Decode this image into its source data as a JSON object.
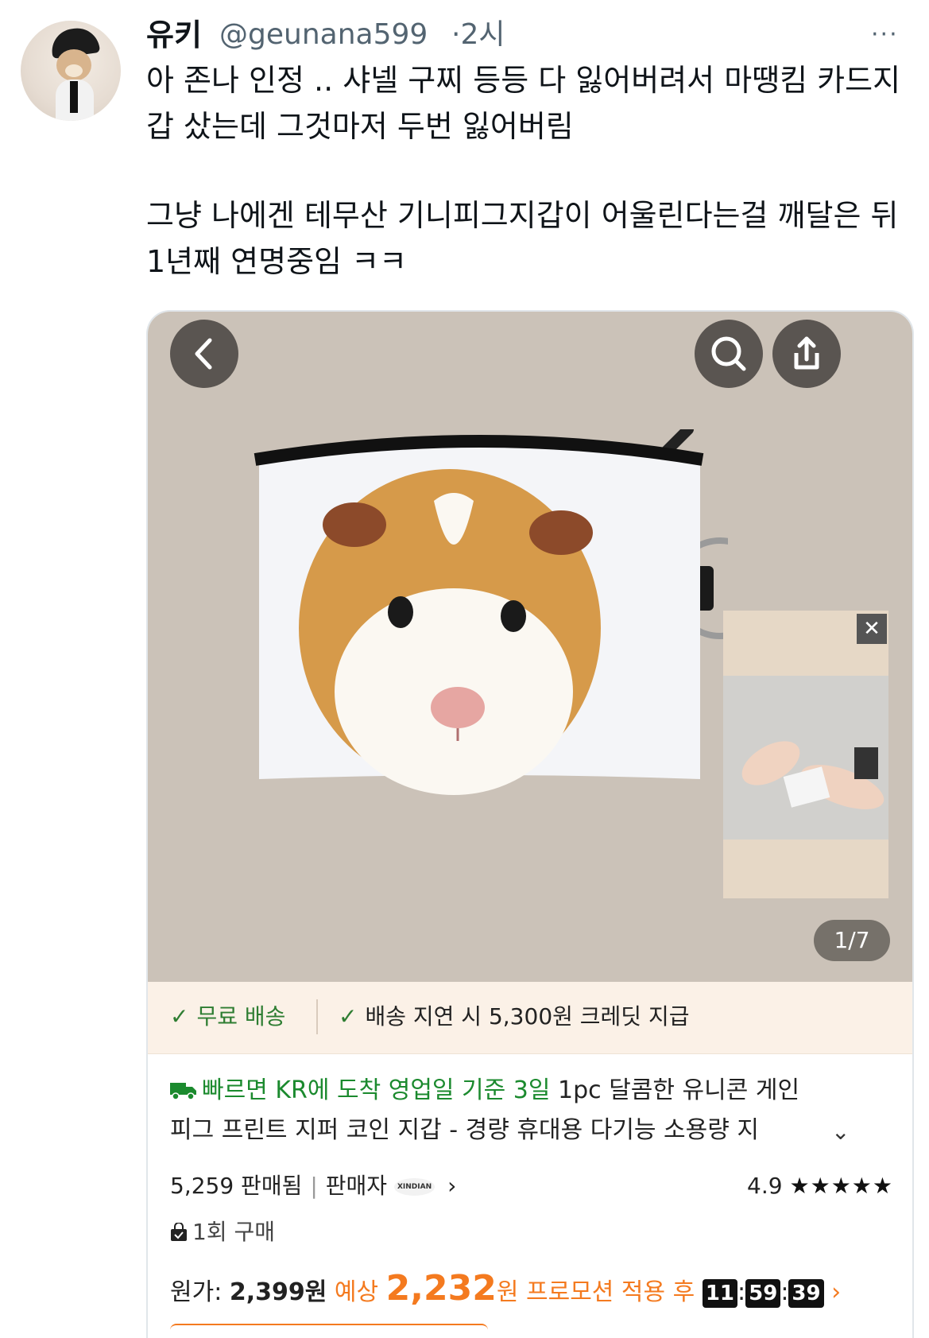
{
  "tweet": {
    "name": "유키",
    "handle": "@geunana599",
    "time": "·2시",
    "more": "···",
    "text_p1": "아 존나 인정 .. 샤넬 구찌 등등 다 잃어버려서 마땡킴 카드지갑 샀는데 그것마저 두번 잃어버림",
    "text_p2": "그냥 나에겐 테무산 기니피그지갑이 어울린다는걸 깨달은 뒤 1년째 연명중임 ㅋㅋ"
  },
  "product": {
    "close": "✕",
    "counter": "1/7",
    "free_shipping": "무료 배송",
    "delay_credit": "배송 지연 시 5,300원 크레딧 지급",
    "delivery": "빠르면 KR에 도착 영업일 기준 3일",
    "title_line1": "1pc 달콤한 유니콘 게인",
    "title_line2": "피그 프린트 지퍼 코인 지갑 - 경량 휴대용 다기능 소용량 지",
    "sold": "5,259 판매됨",
    "seller_label": "판매자",
    "seller_logo": "XINDIAN",
    "rating": "4.9",
    "stars": "★★★★★",
    "purchase": "1회 구매",
    "orig_label": "원가:",
    "orig_price": "2,399원",
    "est_label": "예상",
    "est_price": "2,232",
    "est_unit": "원",
    "promo": "프로모션 적용 후",
    "timer_h": "11",
    "timer_m": "59",
    "timer_s": "39",
    "promo_arrow": "›"
  },
  "icons": [
    "back-icon",
    "search-icon",
    "share-icon",
    "close-icon",
    "check-icon",
    "truck-icon",
    "chevron-down-icon",
    "star-icon",
    "bag-icon"
  ],
  "colors": {
    "green": "#1b8a2e",
    "orange": "#f47a1f",
    "ship_bg": "#fbf1e7",
    "photo_bg": "#cbc2b8"
  }
}
